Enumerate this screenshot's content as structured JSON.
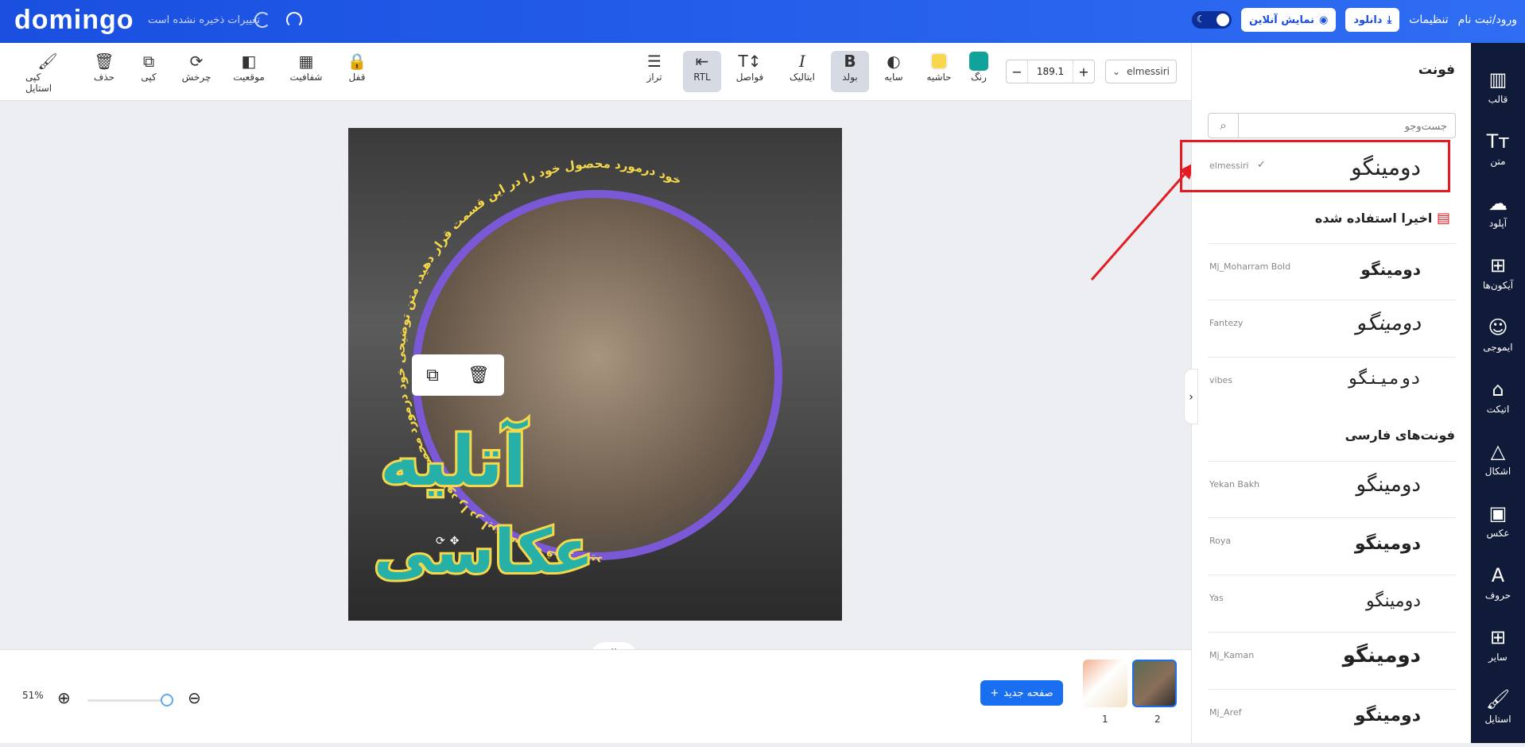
{
  "header": {
    "logo": "domingo",
    "save_status": "تغییرات ذخیره نشده است",
    "login": "ورود/ثبت نام",
    "settings": "تنظیمات",
    "download": "دانلود",
    "online_preview": "نمایش آنلاین"
  },
  "toolbar": {
    "copy_style": "کپی استایل",
    "delete": "حذف",
    "copy": "کپی",
    "rotate": "چرخش",
    "position": "موقعیت",
    "transparency": "شفافیت",
    "lock": "قفل",
    "align": "تراز",
    "rtl": "RTL",
    "spacing": "فواصل",
    "italic": "ایتالیک",
    "bold": "بولد",
    "shadow": "سایه",
    "border": "حاشیه",
    "color": "رنگ",
    "font_size": "189.1",
    "font_name": "elmessiri",
    "colors": {
      "shadow": "#111111",
      "border": "#f7d84c",
      "color": "#0fa39b"
    }
  },
  "rail": [
    {
      "label": "قالب",
      "icon": "template-icon"
    },
    {
      "label": "متن",
      "icon": "text-icon"
    },
    {
      "label": "آپلود",
      "icon": "upload-icon"
    },
    {
      "label": "آیکون‌ها",
      "icon": "grid-icon"
    },
    {
      "label": "ایموجی",
      "icon": "emoji-icon"
    },
    {
      "label": "اتیکت",
      "icon": "tag-icon"
    },
    {
      "label": "اشکال",
      "icon": "shapes-icon"
    },
    {
      "label": "عکس",
      "icon": "image-icon"
    },
    {
      "label": "حروف",
      "icon": "letters-icon"
    },
    {
      "label": "سایر",
      "icon": "more-icon"
    },
    {
      "label": "استایل",
      "icon": "style-icon"
    }
  ],
  "panel": {
    "title": "فونت",
    "search_placeholder": "جست‌وجو",
    "current": {
      "name": "elmessiri",
      "sample": "دومینگو"
    },
    "recent_title": "اخیرا استفاده شده",
    "recent": [
      {
        "name": "Mj_Moharram Bold",
        "sample": "دومینگو"
      },
      {
        "name": "Fantezy",
        "sample": "دومینگو"
      },
      {
        "name": "vibes",
        "sample": "دومینگو"
      }
    ],
    "persian_title": "فونت‌های فارسی",
    "persian": [
      {
        "name": "Yekan Bakh",
        "sample": "دومینگو"
      },
      {
        "name": "Roya",
        "sample": "دومینگو"
      },
      {
        "name": "Yas",
        "sample": "دومینگو"
      },
      {
        "name": "Mj_Kaman",
        "sample": "دومینگو"
      },
      {
        "name": "Mj_Aref",
        "sample": "دومینگو"
      }
    ]
  },
  "canvas": {
    "title_line1": "آتلیه",
    "title_line2": "عکاسی",
    "curved_text": "خود درمورد محصول خود را در این قسمت قرار دهید. متن توضیحی خود درمورد محصول خود را در این قسمت قرار دهید"
  },
  "bottom": {
    "zoom": "51%",
    "zoom_fraction": 0.95,
    "new_page": "صفحه جدید",
    "pages": [
      "1",
      "2"
    ]
  }
}
